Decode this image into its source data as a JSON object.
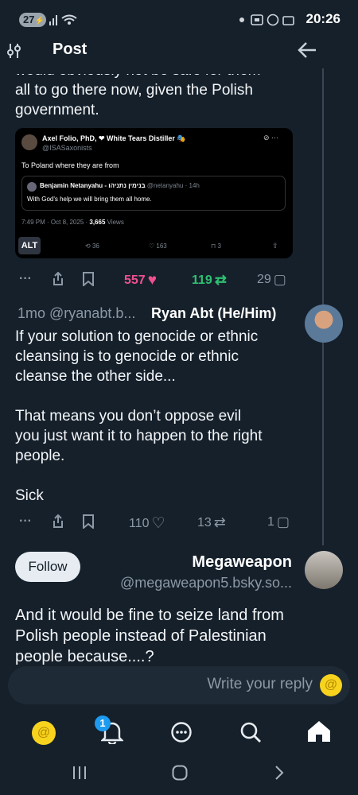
{
  "status_bar": {
    "battery": "27",
    "time": "20:26"
  },
  "header": {
    "title": "Post"
  },
  "root_post": {
    "text": "would obviously not be safe for them\nall to go there now, given the Polish\ngovernment.",
    "quote": {
      "author": "Axel Folio, PhD, ❤ White Tears Distiller 🎭",
      "handle": "@ISASaxonists",
      "text": "To Poland where they are from",
      "inner_author": "Benjamin Netanyahu - בנימין נתניהו",
      "inner_handle": "@netanyahu · 14h",
      "inner_text": "With God's help we will bring them all home.",
      "meta_time": "7:49 PM · Oct 8, 2025 · ",
      "meta_views": "3,665",
      "meta_views_label": " Views",
      "alt": "ALT",
      "reposts": "36",
      "likes": "163",
      "bookmarks": "3"
    },
    "likes": "557",
    "reposts": "119",
    "replies": "29"
  },
  "reply_post": {
    "meta": "1mo @ryanabt.b...",
    "author": "Ryan Abt (He/Him)",
    "text": "If your solution to genocide or ethnic\ncleansing is to genocide or ethnic\ncleanse the other side...\n\nThat means you don’t oppose evil\nyou just want it to happen to the right\npeople.\n\nSick",
    "likes": "110",
    "reposts": "13",
    "replies": "1"
  },
  "next_post": {
    "follow_label": "Follow",
    "author": "Megaweapon",
    "handle": "@megaweapon5.bsky.so...",
    "text": "And it would be fine to seize land from\nPolish people instead of Palestinian\npeople because....?"
  },
  "reply_bar": {
    "placeholder": "Write your reply"
  },
  "tab_bar": {
    "notifications_badge": "1"
  },
  "colors": {
    "background": "#15202b",
    "like": "#f0508f",
    "repost": "#2fbf71",
    "accent": "#1d9bf0",
    "avatar_yellow": "#f8d31e"
  }
}
